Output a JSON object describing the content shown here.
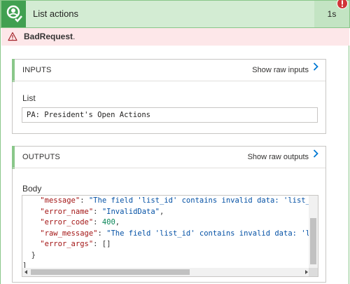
{
  "header": {
    "title": "List actions",
    "duration": "1s",
    "status_color": "#d13438",
    "icon": "check-person-icon"
  },
  "error": {
    "label": "BadRequest",
    "suffix": ".",
    "icon": "warning-triangle-icon"
  },
  "inputs": {
    "section_title": "INPUTS",
    "show_raw_label": "Show raw inputs",
    "field_label": "List",
    "field_value": "PA: President's Open Actions"
  },
  "outputs": {
    "section_title": "OUTPUTS",
    "show_raw_label": "Show raw outputs",
    "field_label": "Body",
    "code_lines": [
      [
        {
          "t": "    ",
          "c": "p"
        },
        {
          "t": "\"message\"",
          "c": "k"
        },
        {
          "t": ": ",
          "c": "p"
        },
        {
          "t": "\"The field 'list_id' contains invalid data: 'list_id",
          "c": "s"
        }
      ],
      [
        {
          "t": "    ",
          "c": "p"
        },
        {
          "t": "\"error_name\"",
          "c": "k"
        },
        {
          "t": ": ",
          "c": "p"
        },
        {
          "t": "\"InvalidData\"",
          "c": "s"
        },
        {
          "t": ",",
          "c": "p"
        }
      ],
      [
        {
          "t": "    ",
          "c": "p"
        },
        {
          "t": "\"error_code\"",
          "c": "k"
        },
        {
          "t": ": ",
          "c": "p"
        },
        {
          "t": "400",
          "c": "n"
        },
        {
          "t": ",",
          "c": "p"
        }
      ],
      [
        {
          "t": "    ",
          "c": "p"
        },
        {
          "t": "\"raw_message\"",
          "c": "k"
        },
        {
          "t": ": ",
          "c": "p"
        },
        {
          "t": "\"The field 'list_id' contains invalid data: 'lis",
          "c": "s"
        }
      ],
      [
        {
          "t": "    ",
          "c": "p"
        },
        {
          "t": "\"error_args\"",
          "c": "k"
        },
        {
          "t": ": []",
          "c": "p"
        }
      ],
      [
        {
          "t": "  }",
          "c": "p"
        }
      ],
      [
        {
          "t": "]",
          "c": "p"
        }
      ]
    ]
  },
  "colors": {
    "success_green": "#41a051",
    "header_bg": "#d3ecd3",
    "error_bg": "#fde7e9",
    "link_blue": "#0078d4"
  }
}
